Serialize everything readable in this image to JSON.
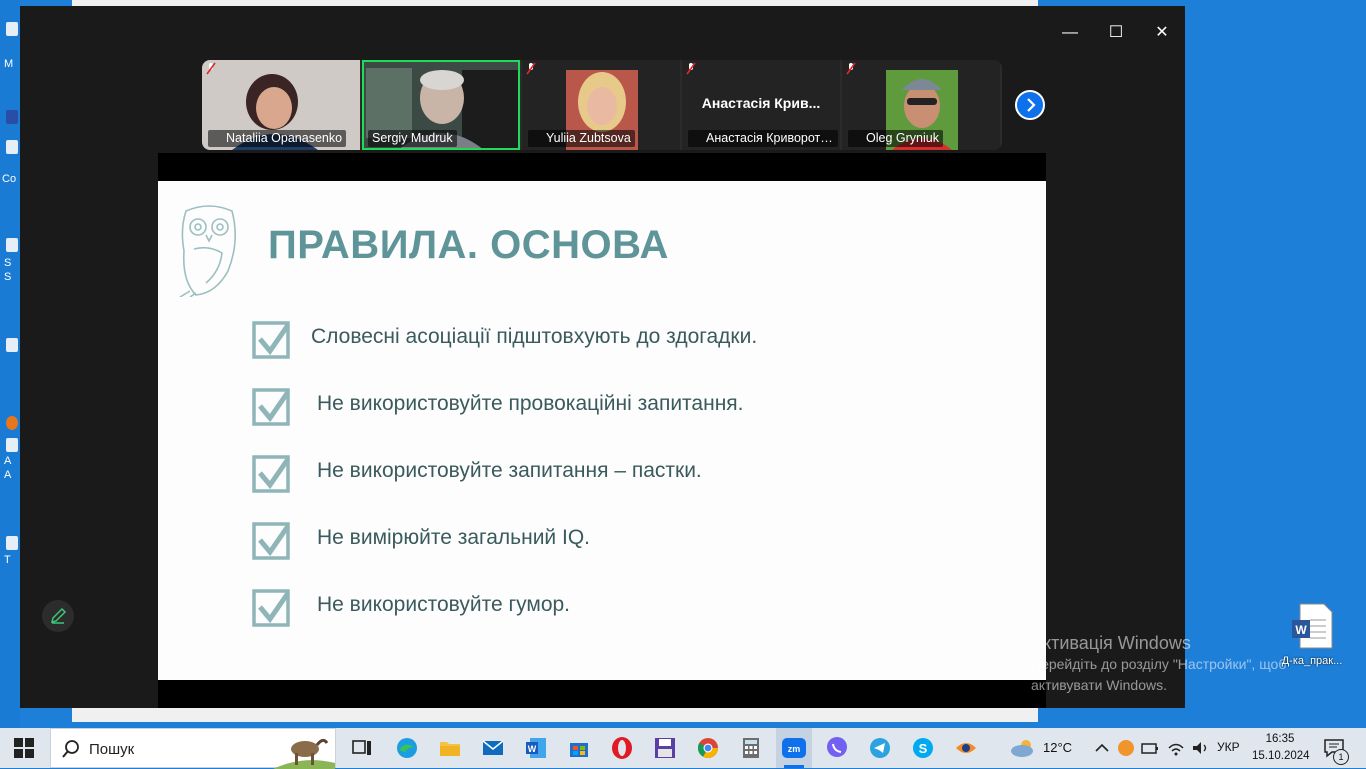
{
  "desktop": {
    "left_fragments": [
      "M",
      "Co",
      "S",
      "S",
      "A",
      "A",
      "T"
    ],
    "file": {
      "label": "Д-ка_прак..."
    }
  },
  "window": {
    "controls": {
      "minimize": "—",
      "maximize": "☐",
      "close": "✕"
    }
  },
  "participants": [
    {
      "name": "Nataliia Opanasenko",
      "muted": true,
      "video": true,
      "active": false
    },
    {
      "name": "Sergiy Mudruk",
      "muted": false,
      "video": true,
      "active": true
    },
    {
      "name": "Yuliia Zubtsova",
      "muted": true,
      "video": true,
      "active": false
    },
    {
      "name": "Анастасія Кривороть...",
      "display_name": "Анастасія Крив...",
      "muted": true,
      "video": false,
      "active": false
    },
    {
      "name": "Oleg Gryniuk",
      "muted": true,
      "video": true,
      "active": false
    }
  ],
  "slide": {
    "title": "ПРАВИЛА. ОСНОВА",
    "items": [
      "Словесні асоціації підштовхують до здогадки.",
      "Не використовуйте провокаційні запитання.",
      "Не використовуйте запитання – пастки.",
      "Не вимірюйте загальний IQ.",
      "Не використовуйте гумор."
    ],
    "accent_color": "#5f9498"
  },
  "watermark": {
    "title": "Активація Windows",
    "line1": "Перейдіть до розділу \"Настройки\", щоб",
    "line2": "активувати Windows."
  },
  "taskbar": {
    "search_label": "Пошук",
    "apps": [
      "task-view",
      "edge",
      "file-explorer",
      "mail",
      "word",
      "store",
      "opera",
      "save-app",
      "chrome",
      "calculator",
      "zoom",
      "viber",
      "telegram",
      "skype",
      "eye-app"
    ],
    "weather": "12°C",
    "language": "УКР",
    "time": "16:35",
    "date": "15.10.2024",
    "notifications": "1"
  }
}
